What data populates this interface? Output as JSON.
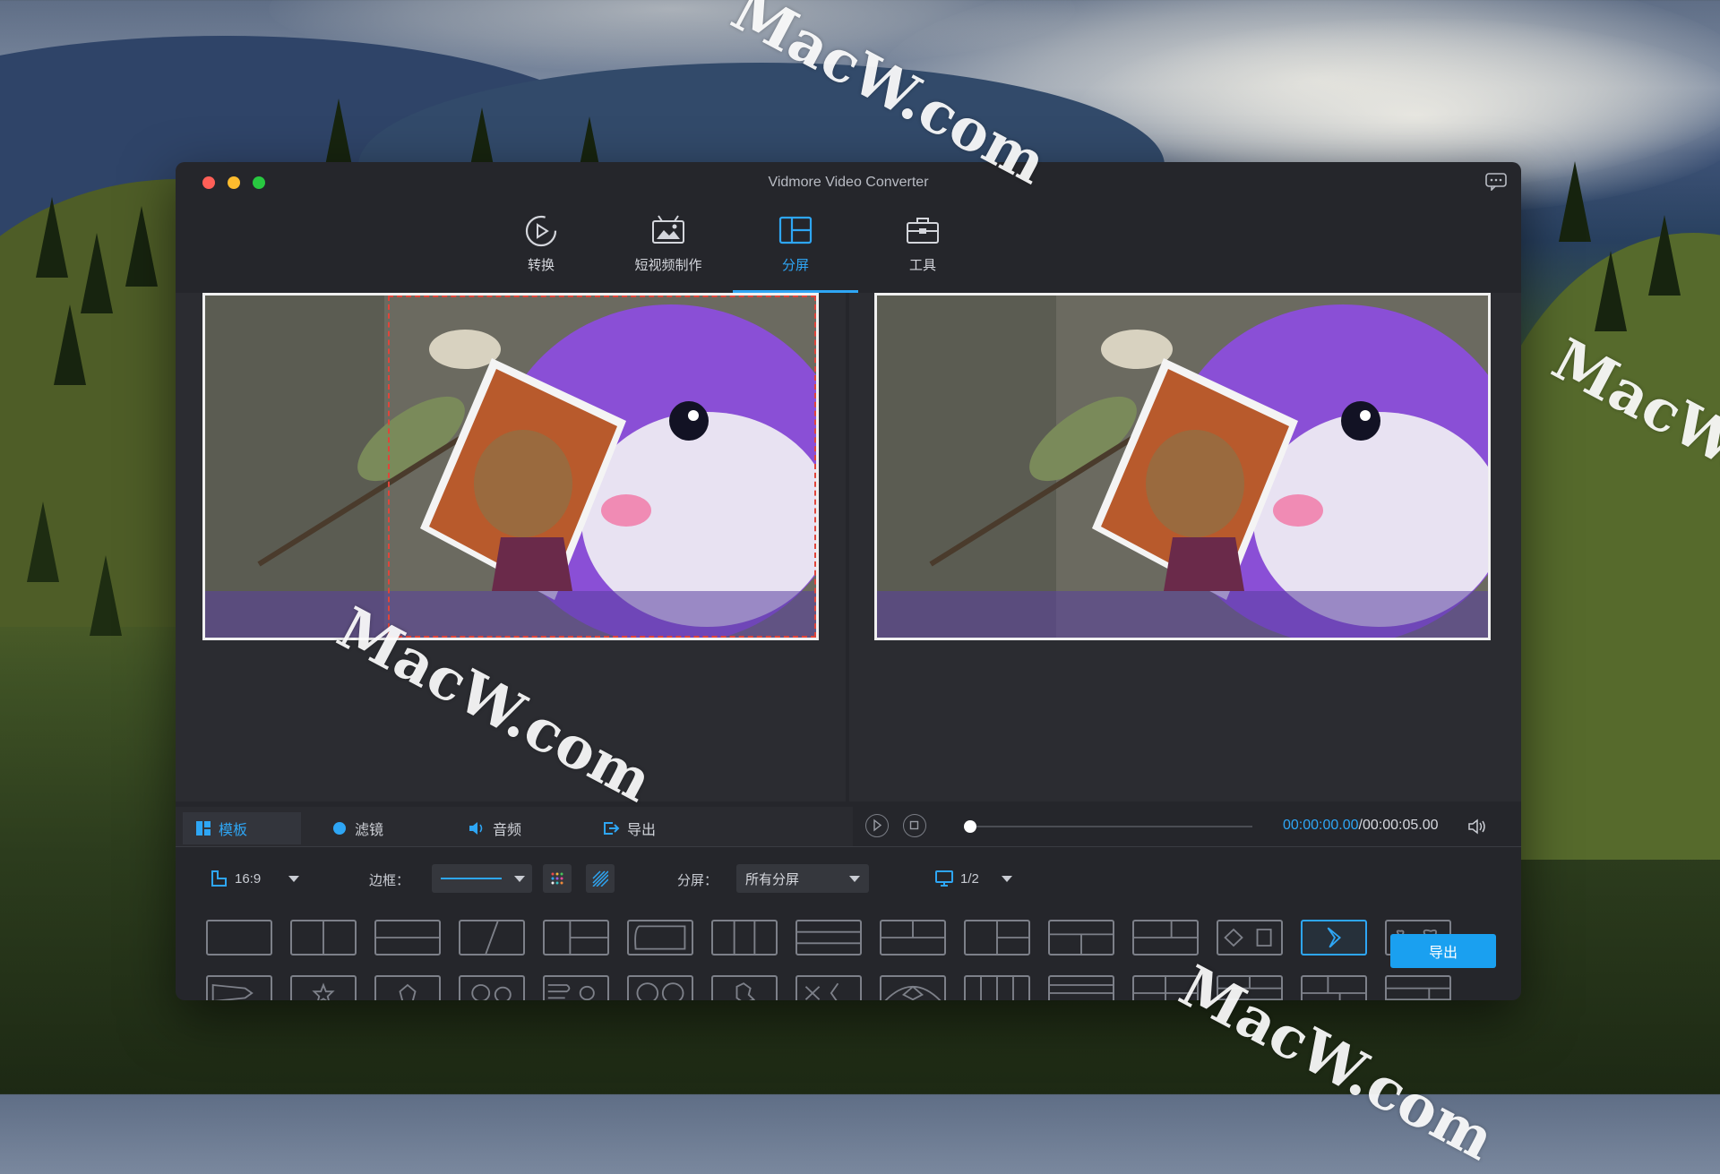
{
  "window": {
    "title": "Vidmore Video Converter",
    "traffic_lights": [
      "#ff5f57",
      "#febc2e",
      "#28c840"
    ],
    "feedback_icon": "chat-bubble-icon"
  },
  "nav_tabs": [
    {
      "label": "转换",
      "icon": "convert-icon",
      "active": false
    },
    {
      "label": "短视频制作",
      "icon": "mv-icon",
      "active": false
    },
    {
      "label": "分屏",
      "icon": "collage-icon",
      "active": true
    },
    {
      "label": "工具",
      "icon": "toolbox-icon",
      "active": false
    }
  ],
  "sub_tabs": [
    {
      "label": "模板",
      "icon": "template-icon",
      "active": true
    },
    {
      "label": "滤镜",
      "icon": "filter-icon",
      "active": false
    },
    {
      "label": "音频",
      "icon": "audio-icon",
      "active": false
    },
    {
      "label": "导出",
      "icon": "export-icon",
      "active": false
    }
  ],
  "player": {
    "time_current": "00:00:00.00",
    "time_total": "/00:00:05.00",
    "progress": 0.0
  },
  "options": {
    "aspect_ratio": "16:9",
    "border_label": "边框：",
    "split_label": "分屏：",
    "split_value": "所有分屏",
    "screen_value": "1/2"
  },
  "template_grid": {
    "rows": 3,
    "cols": 15,
    "selected_row": 0,
    "selected_col": 13
  },
  "export_button": "导出",
  "watermarks": [
    "MacW.com",
    "MacW.com",
    "MacW.com",
    "MacW.com"
  ],
  "colors": {
    "accent": "#2ea6f5",
    "window_bg": "#25262b",
    "selection_dash": "#e0453a"
  }
}
